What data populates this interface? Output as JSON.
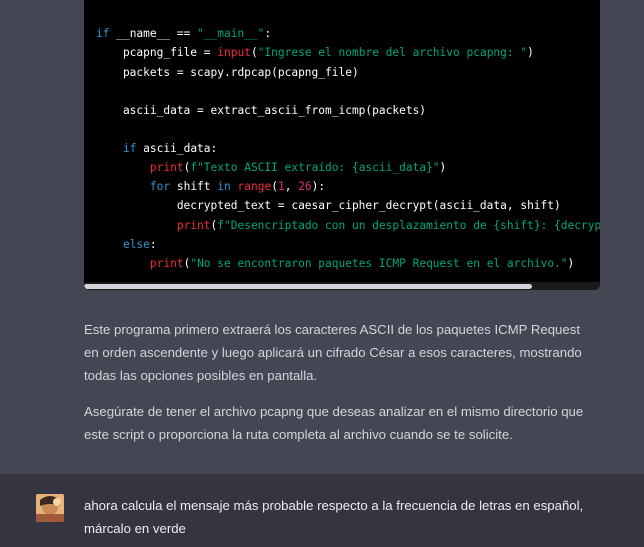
{
  "code": {
    "lines": [
      [
        {
          "t": "kw",
          "v": "if"
        },
        {
          "t": "plain",
          "v": " __name__ == "
        },
        {
          "t": "str",
          "v": "\"__main__\""
        },
        {
          "t": "plain",
          "v": ":"
        }
      ],
      [
        {
          "t": "plain",
          "v": "    pcapng_file = "
        },
        {
          "t": "fn",
          "v": "input"
        },
        {
          "t": "plain",
          "v": "("
        },
        {
          "t": "str",
          "v": "\"Ingrese el nombre del archivo pcapng: \""
        },
        {
          "t": "plain",
          "v": ")"
        }
      ],
      [
        {
          "t": "plain",
          "v": "    packets = scapy.rdpcap(pcapng_file)"
        }
      ],
      [],
      [
        {
          "t": "plain",
          "v": "    ascii_data = extract_ascii_from_icmp(packets)"
        }
      ],
      [],
      [
        {
          "t": "plain",
          "v": "    "
        },
        {
          "t": "kw",
          "v": "if"
        },
        {
          "t": "plain",
          "v": " ascii_data:"
        }
      ],
      [
        {
          "t": "plain",
          "v": "        "
        },
        {
          "t": "fn",
          "v": "print"
        },
        {
          "t": "plain",
          "v": "("
        },
        {
          "t": "str",
          "v": "f\"Texto ASCII extraído: {ascii_data}\""
        },
        {
          "t": "plain",
          "v": ")"
        }
      ],
      [
        {
          "t": "plain",
          "v": "        "
        },
        {
          "t": "kw",
          "v": "for"
        },
        {
          "t": "plain",
          "v": " shift "
        },
        {
          "t": "kw",
          "v": "in"
        },
        {
          "t": "plain",
          "v": " "
        },
        {
          "t": "fn",
          "v": "range"
        },
        {
          "t": "plain",
          "v": "("
        },
        {
          "t": "num",
          "v": "1"
        },
        {
          "t": "plain",
          "v": ", "
        },
        {
          "t": "num",
          "v": "26"
        },
        {
          "t": "plain",
          "v": "):"
        }
      ],
      [
        {
          "t": "plain",
          "v": "            decrypted_text = caesar_cipher_decrypt(ascii_data, shift)"
        }
      ],
      [
        {
          "t": "plain",
          "v": "            "
        },
        {
          "t": "fn",
          "v": "print"
        },
        {
          "t": "plain",
          "v": "("
        },
        {
          "t": "str",
          "v": "f\"Desencriptado con un desplazamiento de {shift}: {decrypt"
        }
      ],
      [
        {
          "t": "plain",
          "v": "    "
        },
        {
          "t": "kw",
          "v": "else"
        },
        {
          "t": "plain",
          "v": ":"
        }
      ],
      [
        {
          "t": "plain",
          "v": "        "
        },
        {
          "t": "fn",
          "v": "print"
        },
        {
          "t": "plain",
          "v": "("
        },
        {
          "t": "str",
          "v": "\"No se encontraron paquetes ICMP Request en el archivo.\""
        },
        {
          "t": "plain",
          "v": ")"
        }
      ]
    ]
  },
  "assistant": {
    "paragraph1": "Este programa primero extraerá los caracteres ASCII de los paquetes ICMP Request en orden ascendente y luego aplicará un cifrado César a esos caracteres, mostrando todas las opciones posibles en pantalla.",
    "paragraph2": "Asegúrate de tener el archivo pcapng que deseas analizar en el mismo directorio que este script o proporciona la ruta completa al archivo cuando se te solicite."
  },
  "user": {
    "message": "ahora calcula el mensaje más probable respecto a la frecuencia de letras en español, márcalo en verde"
  },
  "colors": {
    "background": "#444654",
    "user_background": "#343541",
    "keyword": "#2e95d3",
    "function": "#f22c3d",
    "string": "#00a67d",
    "number": "#df3079"
  }
}
